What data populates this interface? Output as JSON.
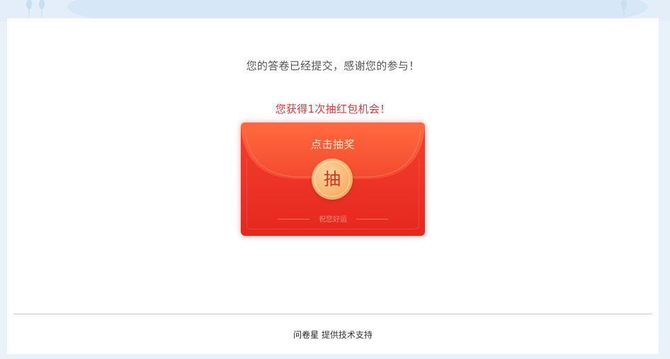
{
  "message": {
    "thanks": "您的答卷已经提交，感谢您的参与！",
    "chance": "您获得1次抽红包机会！"
  },
  "red_packet": {
    "title": "点击抽奖",
    "button_char": "抽",
    "wish": "祝您好运",
    "colors": {
      "envelope": "#f4402f",
      "coin": "#f9b36c",
      "accent_text": "#e0383b"
    }
  },
  "footer": {
    "brand": "问卷星",
    "support_text": "提供技术支持"
  }
}
